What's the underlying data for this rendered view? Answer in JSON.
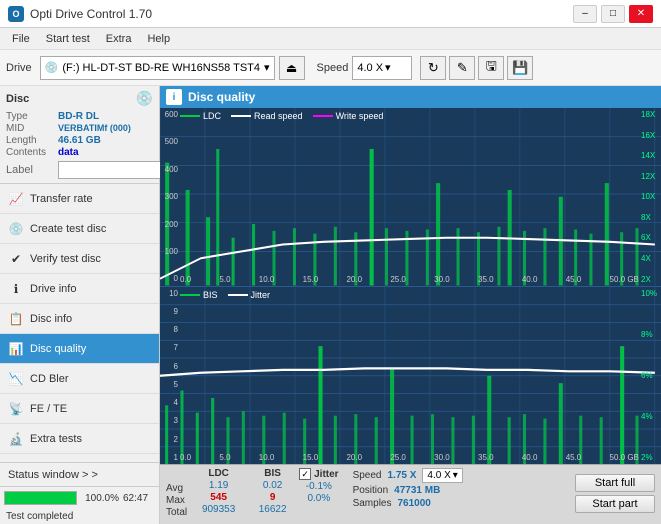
{
  "app": {
    "title": "Opti Drive Control 1.70",
    "icon": "ODC"
  },
  "titlebar": {
    "minimize": "–",
    "maximize": "□",
    "close": "✕"
  },
  "menu": {
    "items": [
      "File",
      "Start test",
      "Extra",
      "Help"
    ]
  },
  "toolbar": {
    "drive_label": "Drive",
    "drive_icon": "💿",
    "drive_name": "(F:) HL-DT-ST BD-RE WH16NS58 TST4",
    "eject_icon": "⏏",
    "speed_label": "Speed",
    "speed_value": "4.0 X",
    "icon_buttons": [
      "↻",
      "🖊",
      "🖫",
      "💾"
    ]
  },
  "disc": {
    "section_label": "Disc",
    "icon": "💿",
    "fields": [
      {
        "name": "Type",
        "value": "BD-R DL"
      },
      {
        "name": "MID",
        "value": "VERBATIMf (000)"
      },
      {
        "name": "Length",
        "value": "46.61 GB"
      },
      {
        "name": "Contents",
        "value": "data"
      },
      {
        "name": "Label",
        "value": ""
      }
    ]
  },
  "nav": {
    "items": [
      {
        "id": "transfer-rate",
        "icon": "📈",
        "label": "Transfer rate"
      },
      {
        "id": "create-test-disc",
        "icon": "💿",
        "label": "Create test disc"
      },
      {
        "id": "verify-test-disc",
        "icon": "✔",
        "label": "Verify test disc"
      },
      {
        "id": "drive-info",
        "icon": "ℹ",
        "label": "Drive info"
      },
      {
        "id": "disc-info",
        "icon": "📋",
        "label": "Disc info"
      },
      {
        "id": "disc-quality",
        "icon": "📊",
        "label": "Disc quality",
        "active": true
      },
      {
        "id": "cd-bler",
        "icon": "📉",
        "label": "CD Bler"
      },
      {
        "id": "fe-te",
        "icon": "📡",
        "label": "FE / TE"
      },
      {
        "id": "extra-tests",
        "icon": "🔬",
        "label": "Extra tests"
      }
    ]
  },
  "disc_quality": {
    "title": "Disc quality",
    "legend": {
      "items": [
        {
          "label": "LDC",
          "color": "#00ff00"
        },
        {
          "label": "Read speed",
          "color": "#ffffff"
        },
        {
          "label": "Write speed",
          "color": "#ff00ff"
        }
      ]
    },
    "legend2": {
      "items": [
        {
          "label": "BIS",
          "color": "#00ff00"
        },
        {
          "label": "Jitter",
          "color": "#ffffff"
        }
      ]
    },
    "chart1": {
      "y_left": [
        "600",
        "500",
        "400",
        "300",
        "200",
        "100",
        "0"
      ],
      "y_right": [
        "18X",
        "16X",
        "14X",
        "12X",
        "10X",
        "8X",
        "6X",
        "4X",
        "2X"
      ],
      "x_labels": [
        "0.0",
        "5.0",
        "10.0",
        "15.0",
        "20.0",
        "25.0",
        "30.0",
        "35.0",
        "40.0",
        "45.0",
        "50.0 GB"
      ]
    },
    "chart2": {
      "y_left": [
        "10",
        "9",
        "8",
        "7",
        "6",
        "5",
        "4",
        "3",
        "2",
        "1"
      ],
      "y_right": [
        "10%",
        "8%",
        "6%",
        "4%",
        "2%"
      ],
      "x_labels": [
        "0.0",
        "5.0",
        "10.0",
        "15.0",
        "20.0",
        "25.0",
        "30.0",
        "35.0",
        "40.0",
        "45.0",
        "50.0 GB"
      ]
    }
  },
  "stats": {
    "headers": [
      "LDC",
      "BIS",
      "Jitter"
    ],
    "rows": [
      {
        "label": "Avg",
        "ldc": "1.19",
        "bis": "0.02",
        "jitter": "-0.1%"
      },
      {
        "label": "Max",
        "ldc": "545",
        "bis": "9",
        "jitter": "0.0%"
      },
      {
        "label": "Total",
        "ldc": "909353",
        "bis": "16622",
        "jitter": ""
      }
    ],
    "speed_label": "Speed",
    "speed_value": "1.75 X",
    "speed_select": "4.0 X",
    "position_label": "Position",
    "position_value": "47731 MB",
    "samples_label": "Samples",
    "samples_value": "761000",
    "jitter_label": "Jitter",
    "jitter_checked": true,
    "buttons": {
      "start_full": "Start full",
      "start_part": "Start part"
    }
  },
  "statusbar": {
    "status_window": "Status window > >",
    "status_text": "Test completed",
    "progress_value": 100,
    "progress_display": "100.0%",
    "time": "62:47"
  }
}
